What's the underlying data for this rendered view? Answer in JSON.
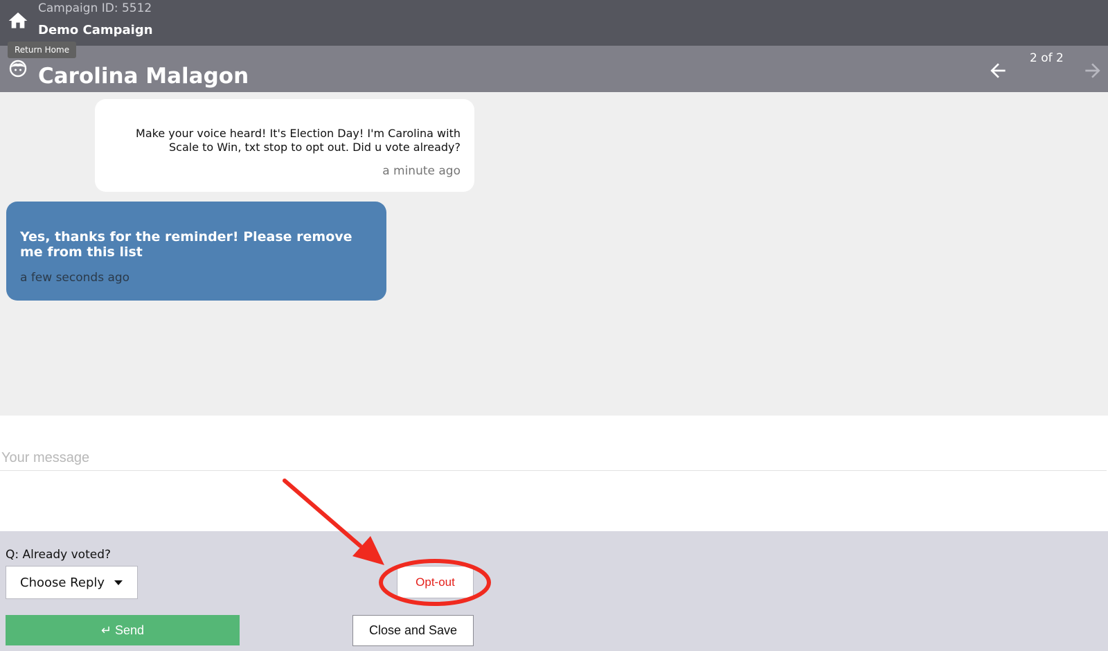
{
  "header": {
    "campaign_id": "Campaign ID: 5512",
    "campaign_name": "Demo Campaign",
    "home_tooltip": "Return Home"
  },
  "contact": {
    "name": "Carolina Malagon",
    "position_text": "2 of 2"
  },
  "messages": [
    {
      "direction": "outgoing",
      "text": "Make your voice heard! It's Election Day! I'm Carolina with Scale to Win, txt stop to opt out. Did u vote already?",
      "time": "a minute ago"
    },
    {
      "direction": "incoming",
      "text": "Yes, thanks for the reminder! Please remove me from this list",
      "time": "a few seconds ago"
    }
  ],
  "composer": {
    "placeholder": "Your message",
    "value": ""
  },
  "actions": {
    "question": "Q: Already voted?",
    "choose_reply_label": "Choose Reply",
    "send_label": "↵ Send",
    "optout_label": "Opt-out",
    "close_save_label": "Close and Save"
  },
  "colors": {
    "topbar": "#55565e",
    "contactbar": "#808089",
    "incoming_bubble": "#4f81b3",
    "send_button": "#55b776",
    "optout_text": "#e41f1a",
    "annotation": "#f02a1f"
  },
  "icons": {
    "home": "home-icon",
    "avatar": "face-icon",
    "prev": "arrow-left-icon",
    "next": "arrow-right-icon",
    "dropdown": "caret-down-icon"
  }
}
